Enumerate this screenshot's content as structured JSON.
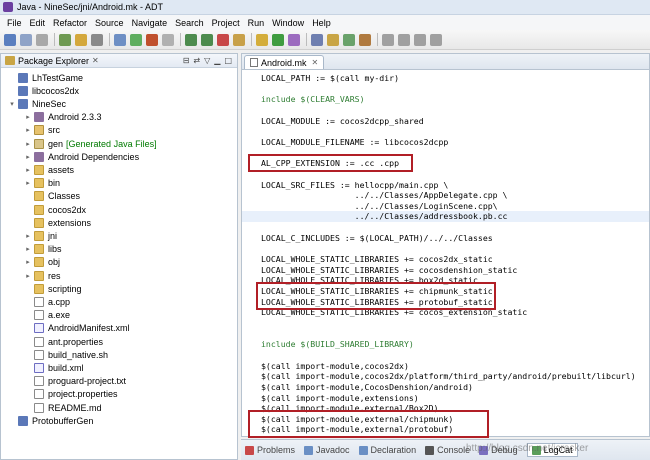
{
  "window": {
    "title": "Java - NineSec/jni/Android.mk - ADT"
  },
  "menu": [
    "File",
    "Edit",
    "Refactor",
    "Source",
    "Navigate",
    "Search",
    "Project",
    "Run",
    "Window",
    "Help"
  ],
  "explorer": {
    "tab_label": "Package Explorer",
    "items": [
      {
        "label": "LhTestGame",
        "icon": "project-icon",
        "depth": 0,
        "twisty": ""
      },
      {
        "label": "libcocos2dx",
        "icon": "project-icon",
        "depth": 0,
        "twisty": ""
      },
      {
        "label": "NineSec",
        "icon": "project-icon",
        "depth": 0,
        "twisty": "v"
      },
      {
        "label": "Android 2.3.3",
        "icon": "library-icon",
        "depth": 1,
        "twisty": ">"
      },
      {
        "label": "src",
        "icon": "source-folder-icon",
        "depth": 1,
        "twisty": ">"
      },
      {
        "label": "gen",
        "suffix": "[Generated Java Files]",
        "icon": "gen-folder-icon",
        "depth": 1,
        "twisty": ">"
      },
      {
        "label": "Android Dependencies",
        "icon": "library-icon",
        "depth": 1,
        "twisty": ">"
      },
      {
        "label": "assets",
        "icon": "folder-icon",
        "depth": 1,
        "twisty": ">"
      },
      {
        "label": "bin",
        "icon": "folder-icon",
        "depth": 1,
        "twisty": ">"
      },
      {
        "label": "Classes",
        "icon": "folder-icon",
        "depth": 1,
        "twisty": ""
      },
      {
        "label": "cocos2dx",
        "icon": "folder-icon",
        "depth": 1,
        "twisty": ""
      },
      {
        "label": "extensions",
        "icon": "folder-icon",
        "depth": 1,
        "twisty": ""
      },
      {
        "label": "jni",
        "icon": "folder-icon",
        "depth": 1,
        "twisty": ">"
      },
      {
        "label": "libs",
        "icon": "folder-icon",
        "depth": 1,
        "twisty": ">"
      },
      {
        "label": "obj",
        "icon": "folder-icon",
        "depth": 1,
        "twisty": ">"
      },
      {
        "label": "res",
        "icon": "folder-icon",
        "depth": 1,
        "twisty": ">"
      },
      {
        "label": "scripting",
        "icon": "folder-icon",
        "depth": 1,
        "twisty": ""
      },
      {
        "label": "a.cpp",
        "icon": "file-icon",
        "depth": 1,
        "twisty": ""
      },
      {
        "label": "a.exe",
        "icon": "file-icon",
        "depth": 1,
        "twisty": ""
      },
      {
        "label": "AndroidManifest.xml",
        "icon": "xml-file-icon",
        "depth": 1,
        "twisty": ""
      },
      {
        "label": "ant.properties",
        "icon": "file-icon",
        "depth": 1,
        "twisty": ""
      },
      {
        "label": "build_native.sh",
        "icon": "file-icon",
        "depth": 1,
        "twisty": ""
      },
      {
        "label": "build.xml",
        "icon": "xml-file-icon",
        "depth": 1,
        "twisty": ""
      },
      {
        "label": "proguard-project.txt",
        "icon": "file-icon",
        "depth": 1,
        "twisty": ""
      },
      {
        "label": "project.properties",
        "icon": "file-icon",
        "depth": 1,
        "twisty": ""
      },
      {
        "label": "README.md",
        "icon": "file-icon",
        "depth": 1,
        "twisty": ""
      },
      {
        "label": "ProtobufferGen",
        "icon": "project-icon",
        "depth": 0,
        "twisty": ""
      }
    ]
  },
  "editor": {
    "tab_label": "Android.mk",
    "lines": [
      "LOCAL_PATH := $(call my-dir)",
      "",
      "include $(CLEAR_VARS)",
      "",
      "LOCAL_MODULE := cocos2dcpp_shared",
      "",
      "LOCAL_MODULE_FILENAME := libcocos2dcpp",
      "",
      "AL_CPP_EXTENSION := .cc .cpp",
      "",
      "LOCAL_SRC_FILES := hellocpp/main.cpp \\",
      "                   ../../Classes/AppDelegate.cpp \\",
      "                   ../../Classes/LoginScene.cpp\\",
      "                   ../../Classes/addressbook.pb.cc",
      "",
      "LOCAL_C_INCLUDES := $(LOCAL_PATH)/../../Classes",
      "",
      "LOCAL_WHOLE_STATIC_LIBRARIES += cocos2dx_static",
      "LOCAL_WHOLE_STATIC_LIBRARIES += cocosdenshion_static",
      "LOCAL_WHOLE_STATIC_LIBRARIES += box2d_static",
      "LOCAL_WHOLE_STATIC_LIBRARIES += chipmunk_static",
      "LOCAL_WHOLE_STATIC_LIBRARIES += protobuf_static",
      "LOCAL_WHOLE_STATIC_LIBRARIES += cocos_extension_static",
      "",
      "",
      "include $(BUILD_SHARED_LIBRARY)",
      "",
      "$(call import-module,cocos2dx)",
      "$(call import-module,cocos2dx/platform/third_party/android/prebuilt/libcurl)",
      "$(call import-module,CocosDenshion/android)",
      "$(call import-module,extensions)",
      "$(call import-module,external/Box2D)",
      "$(call import-module,external/chipmunk)",
      "$(call import-module,external/protobuf)"
    ]
  },
  "bottom_tabs": [
    "Problems",
    "Javadoc",
    "Declaration",
    "Console",
    "Debug",
    "LogCat"
  ],
  "active_bottom_tab": "LogCat",
  "watermark": "http://blog.csdn.net/jcracker",
  "colors": {
    "highlight_box": "#b11f26",
    "include_keyword": "#2e7d32"
  }
}
